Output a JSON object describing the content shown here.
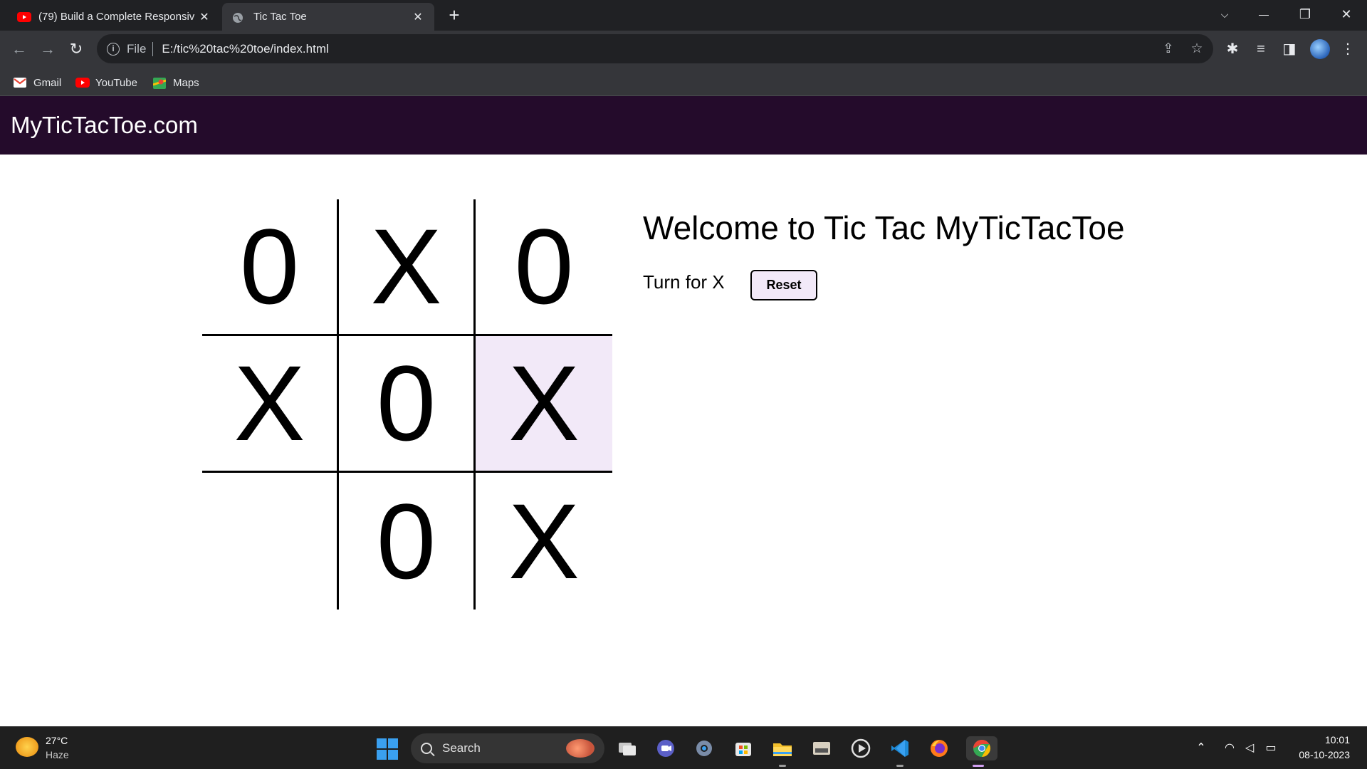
{
  "browser": {
    "tabs": [
      {
        "title": "(79) Build a Complete Responsiv",
        "close": "✕"
      },
      {
        "title": "Tic Tac Toe",
        "close": "✕"
      }
    ],
    "new_tab": "+",
    "window_controls": {
      "dropdown": "⌵",
      "minimize": "—",
      "restore": "❐",
      "close": "✕"
    },
    "nav": {
      "back": "←",
      "forward": "→",
      "reload": "↻"
    },
    "address": {
      "info": "i",
      "scheme_label": "File",
      "url": "E:/tic%20tac%20toe/index.html"
    },
    "omnibox_icons": {
      "share": "⇪",
      "bookmark": "☆"
    },
    "toolbar_icons": {
      "extensions": "✱",
      "media": "≡",
      "sidepanel": "◨",
      "menu": "⋮"
    },
    "bookmarks": [
      {
        "label": "Gmail",
        "color": "#ea4335"
      },
      {
        "label": "YouTube",
        "color": "#ff0000"
      },
      {
        "label": "Maps",
        "color": "#34a853"
      }
    ]
  },
  "site": {
    "brand": "MyTicTacToe.com",
    "board": [
      "0",
      "X",
      "0",
      "X",
      "0",
      "X",
      "",
      "0",
      "X"
    ],
    "highlight_color": "#f2e9f8",
    "nav_color": "#240b2b",
    "welcome": "Welcome to Tic Tac MyTicTacToe",
    "turn": "Turn for X",
    "reset_label": "Reset"
  },
  "taskbar": {
    "weather": {
      "temp": "27°C",
      "condition": "Haze"
    },
    "search_placeholder": "Search",
    "tray": {
      "chevron": "⌃",
      "wifi": "◠",
      "volume": "◁",
      "battery": "▭"
    },
    "clock": {
      "time": "10:01",
      "date": "08-10-2023"
    }
  }
}
